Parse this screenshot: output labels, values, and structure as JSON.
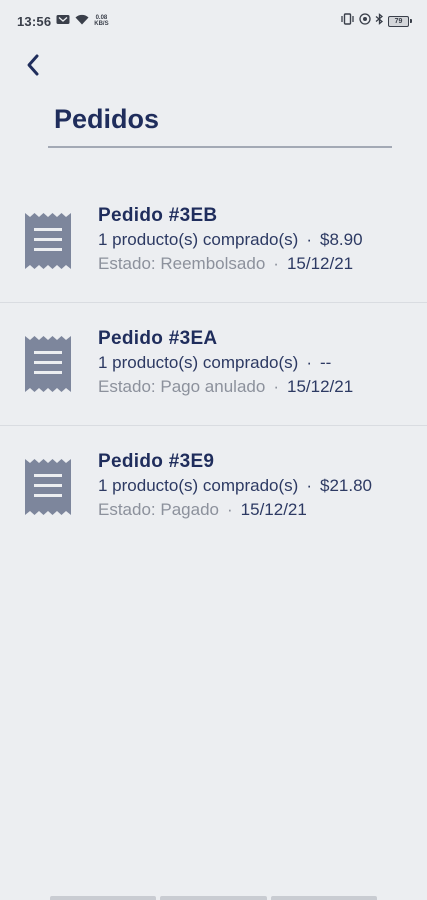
{
  "status_bar": {
    "time": "13:56",
    "net_speed_value": "0.08",
    "net_speed_unit": "KB/S",
    "battery": "79"
  },
  "header": {
    "back_icon": "chevron-left-icon",
    "title": "Pedidos"
  },
  "colors": {
    "background": "#eceef1",
    "primary": "#1f2d5c",
    "icon": "#7d869c",
    "muted": "#8c919c"
  },
  "orders": [
    {
      "title": "Pedido #3EB",
      "products": "1 producto(s) comprado(s)",
      "amount": "$8.90",
      "status": "Estado: Reembolsado",
      "date": "15/12/21",
      "icon": "receipt-icon"
    },
    {
      "title": "Pedido #3EA",
      "products": "1 producto(s) comprado(s)",
      "amount": "--",
      "status": "Estado: Pago anulado",
      "date": "15/12/21",
      "icon": "receipt-icon"
    },
    {
      "title": "Pedido #3E9",
      "products": "1 producto(s) comprado(s)",
      "amount": "$21.80",
      "status": "Estado: Pagado",
      "date": "15/12/21",
      "icon": "receipt-icon"
    }
  ],
  "separator": "·"
}
